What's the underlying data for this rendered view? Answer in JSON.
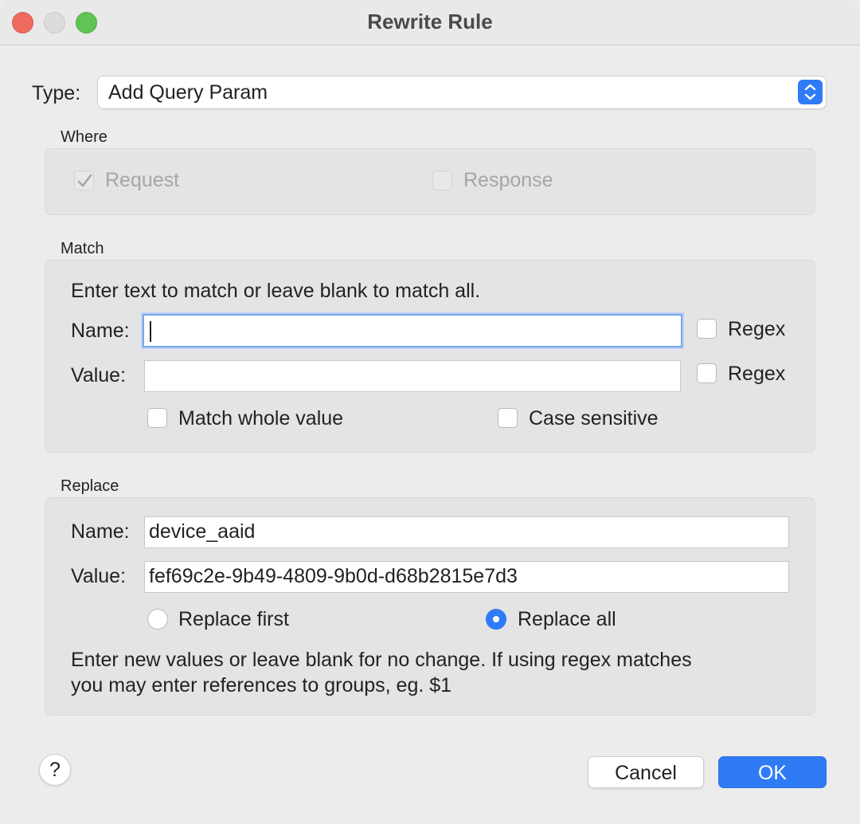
{
  "window": {
    "title": "Rewrite Rule"
  },
  "type": {
    "label": "Type:",
    "value": "Add Query Param"
  },
  "where": {
    "label": "Where",
    "request": {
      "label": "Request",
      "checked": true,
      "disabled": true
    },
    "response": {
      "label": "Response",
      "checked": false,
      "disabled": true
    }
  },
  "match": {
    "label": "Match",
    "hint": "Enter text to match or leave blank to match all.",
    "name_label": "Name:",
    "name_value": "",
    "value_label": "Value:",
    "value_value": "",
    "regex_label": "Regex",
    "match_whole_value_label": "Match whole value",
    "case_sensitive_label": "Case sensitive"
  },
  "replace": {
    "label": "Replace",
    "name_label": "Name:",
    "name_value": "device_aaid",
    "value_label": "Value:",
    "value_value": "fef69c2e-9b49-4809-9b0d-d68b2815e7d3",
    "replace_first_label": "Replace first",
    "replace_all_label": "Replace all",
    "selected": "Replace all",
    "hint_line1": "Enter new values or leave blank for no change. If using regex matches",
    "hint_line2": "you may enter references to groups, eg. $1"
  },
  "buttons": {
    "help": "?",
    "cancel": "Cancel",
    "ok": "OK"
  },
  "colors": {
    "accent": "#2f7bf5",
    "close": "#ee6a5f",
    "maximize": "#5fc453"
  },
  "icons": [
    "checkmark-icon",
    "updown-chevron-icon",
    "help-icon"
  ]
}
